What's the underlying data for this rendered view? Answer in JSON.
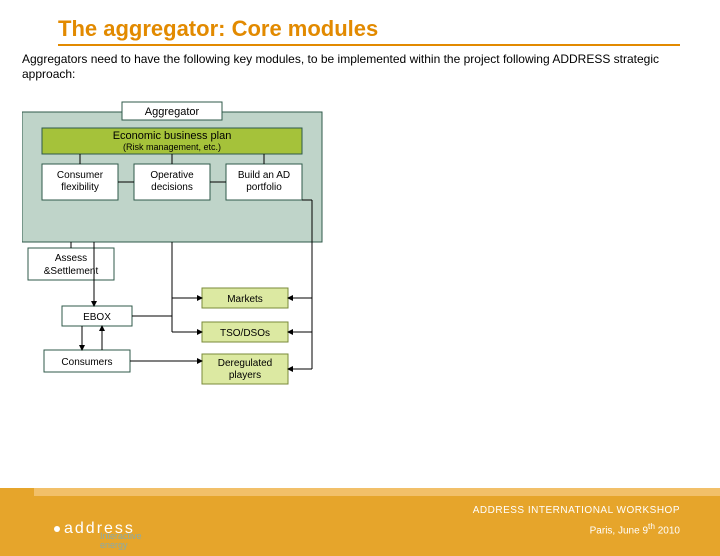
{
  "title": "The aggregator: Core modules",
  "intro": "Aggregators need to have the following key modules, to be implemented within the project following ADDRESS strategic approach:",
  "diagram": {
    "container_label": "Aggregator",
    "plan": "Economic business plan",
    "plan_sub": "(Risk management, etc.)",
    "mod1a": "Consumer",
    "mod1b": "flexibility",
    "mod2a": "Operative",
    "mod2b": "decisions",
    "mod3a": "Build an AD",
    "mod3b": "portfolio",
    "assess1": "Assess",
    "assess2": "&Settlement",
    "ebox": "EBOX",
    "markets": "Markets",
    "tsodsos": "TSO/DSOs",
    "dereg1": "Deregulated",
    "dereg2": "players",
    "consumers": "Consumers"
  },
  "footer": {
    "logo": "address",
    "tag1": "Interactive",
    "tag2": "energy",
    "workshop": "ADDRESS INTERNATIONAL WORKSHOP",
    "location": "Paris, June 9",
    "sup": "th",
    "year": " 2010"
  }
}
